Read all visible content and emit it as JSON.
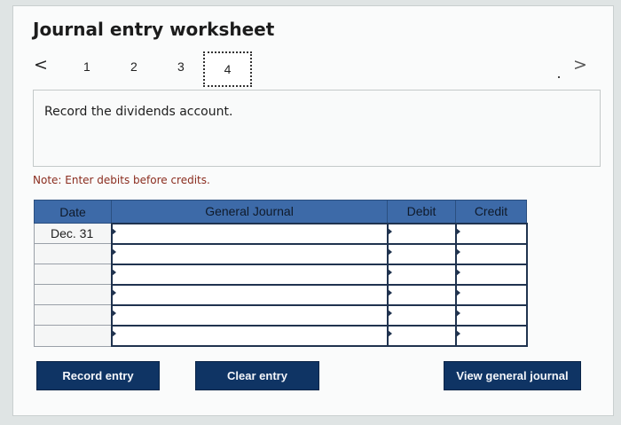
{
  "header": {
    "title": "Journal entry worksheet"
  },
  "nav": {
    "prev_icon": "chevron-left-icon",
    "next_icon": "chevron-right-icon",
    "prev_glyph": "<",
    "next_glyph": ">",
    "tabs": [
      "1",
      "2",
      "3",
      "4"
    ],
    "active_tab": "4"
  },
  "instruction": {
    "text": "Record the dividends account."
  },
  "note": {
    "text": "Note: Enter debits before credits."
  },
  "table": {
    "headers": {
      "date": "Date",
      "journal": "General Journal",
      "debit": "Debit",
      "credit": "Credit"
    },
    "rows": [
      {
        "date": "Dec. 31",
        "account": "",
        "debit": "",
        "credit": ""
      },
      {
        "date": "",
        "account": "",
        "debit": "",
        "credit": ""
      },
      {
        "date": "",
        "account": "",
        "debit": "",
        "credit": ""
      },
      {
        "date": "",
        "account": "",
        "debit": "",
        "credit": ""
      },
      {
        "date": "",
        "account": "",
        "debit": "",
        "credit": ""
      },
      {
        "date": "",
        "account": "",
        "debit": "",
        "credit": ""
      }
    ]
  },
  "buttons": {
    "record": "Record entry",
    "clear": "Clear entry",
    "view": "View general journal"
  },
  "colors": {
    "header_blue": "#3d6aa8",
    "button_navy": "#0f3464",
    "note_red": "#8a2c1e"
  }
}
